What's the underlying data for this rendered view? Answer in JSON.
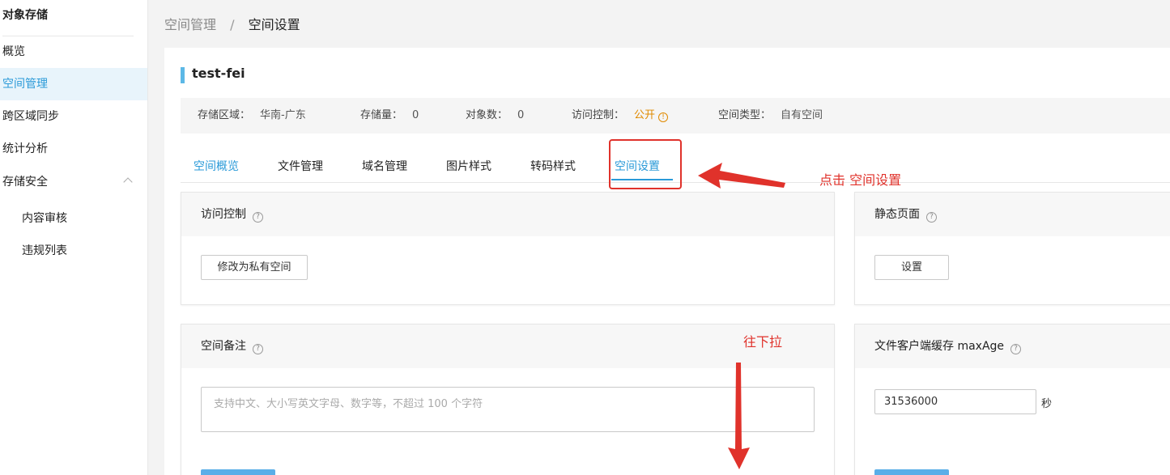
{
  "sidebar": {
    "title": "对象存储",
    "items": [
      {
        "label": "概览"
      },
      {
        "label": "空间管理"
      },
      {
        "label": "跨区域同步"
      },
      {
        "label": "统计分析"
      },
      {
        "label": "存储安全"
      },
      {
        "label": "内容审核"
      },
      {
        "label": "违规列表"
      }
    ]
  },
  "breadcrumb": {
    "parent": "空间管理",
    "separator": "/",
    "current": "空间设置"
  },
  "bucket": {
    "name": "test-fei"
  },
  "info": {
    "region_label": "存储区域：",
    "region_value": "华南-广东",
    "storage_label": "存储量：",
    "storage_value": "0",
    "objects_label": "对象数：",
    "objects_value": "0",
    "access_label": "访问控制：",
    "access_value": "公开",
    "type_label": "空间类型：",
    "type_value": "自有空间"
  },
  "tabs": [
    {
      "label": "空间概览"
    },
    {
      "label": "文件管理"
    },
    {
      "label": "域名管理"
    },
    {
      "label": "图片样式"
    },
    {
      "label": "转码样式"
    },
    {
      "label": "空间设置"
    }
  ],
  "cards": {
    "access": {
      "title": "访问控制",
      "button": "修改为私有空间"
    },
    "static": {
      "title": "静态页面",
      "button": "设置"
    },
    "remark": {
      "title": "空间备注",
      "placeholder": "支持中文、大小写英文字母、数字等，不超过 100 个字符"
    },
    "maxage": {
      "title": "文件客户端缓存 maxAge",
      "value": "31536000",
      "unit": "秒"
    }
  },
  "annotations": {
    "click_hint": "点击 空间设置",
    "scroll_hint": "往下拉",
    "color": "#e0322b"
  },
  "colors": {
    "accent": "#2a9ad8",
    "warning": "#e08a00",
    "title_bar": "#5cb8e6"
  }
}
